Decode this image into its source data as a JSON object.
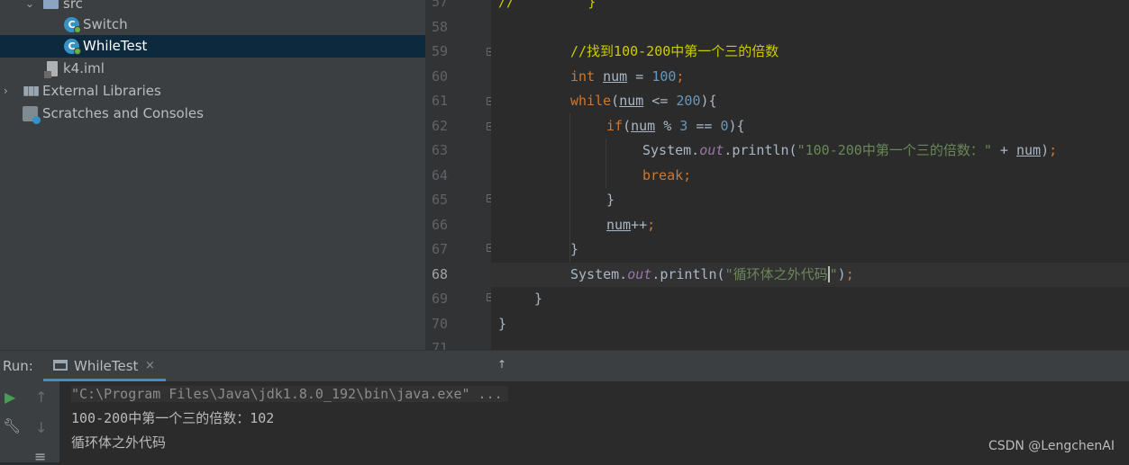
{
  "project_tree": {
    "items": [
      {
        "label": "src",
        "kind": "folder"
      },
      {
        "label": "Switch",
        "kind": "class"
      },
      {
        "label": "WhileTest",
        "kind": "class",
        "selected": true
      },
      {
        "label": "k4.iml",
        "kind": "file"
      },
      {
        "label": "External Libraries",
        "kind": "library"
      },
      {
        "label": "Scratches and Consoles",
        "kind": "scratch"
      }
    ]
  },
  "editor": {
    "line_numbers": [
      "57",
      "58",
      "59",
      "60",
      "61",
      "62",
      "63",
      "64",
      "65",
      "66",
      "67",
      "68",
      "69",
      "70",
      "71"
    ],
    "current_line": "68",
    "code": {
      "l57_a": "//",
      "l57_b": "}",
      "l59_comment": "//找到100-200中第一个三的倍数",
      "l60_kw": "int",
      "l60_var": "num",
      "l60_eq": " = ",
      "l60_num": "100",
      "l60_semi": ";",
      "l61_kw": "while",
      "l61_open": "(",
      "l61_var": "num",
      "l61_op": " <= ",
      "l61_num": "200",
      "l61_close": "){",
      "l62_kw": "if",
      "l62_open": "(",
      "l62_var": "num",
      "l62_op": " % ",
      "l62_num1": "3",
      "l62_op2": " == ",
      "l62_num2": "0",
      "l62_close": "){",
      "l63_sys": "System.",
      "l63_out": "out",
      "l63_call": ".println(",
      "l63_str": "\"100-200中第一个三的倍数：\"",
      "l63_plus": " + ",
      "l63_var": "num",
      "l63_close": ")",
      "l63_semi": ";",
      "l64_kw": "break",
      "l64_semi": ";",
      "l65": "}",
      "l66_var": "num",
      "l66_op": "++",
      "l66_semi": ";",
      "l67": "}",
      "l68_sys": "System.",
      "l68_out": "out",
      "l68_call": ".println(",
      "l68_str_a": "\"循环体之外代码",
      "l68_str_b": "\"",
      "l68_close": ")",
      "l68_semi": ";",
      "l69": "}",
      "l70": "}"
    }
  },
  "run_panel": {
    "label": "Run:",
    "tab_title": "WhileTest",
    "tab_close": "×",
    "console": {
      "command": "\"C:\\Program Files\\Java\\jdk1.8.0_192\\bin\\java.exe\" ...",
      "output_1": "100-200中第一个三的倍数：102",
      "output_2": "循环体之外代码"
    },
    "side_buttons": [
      "run-icon",
      "up-arrow-icon",
      "wrench-icon",
      "down-arrow-icon",
      "soft-wrap-icon"
    ]
  },
  "watermark": "CSDN @LengchenAI",
  "colors": {
    "keyword": "#cc7832",
    "number": "#6897bb",
    "string": "#6a8759",
    "field": "#9876aa",
    "selection": "#0d293e",
    "accent": "#4a88c7"
  }
}
